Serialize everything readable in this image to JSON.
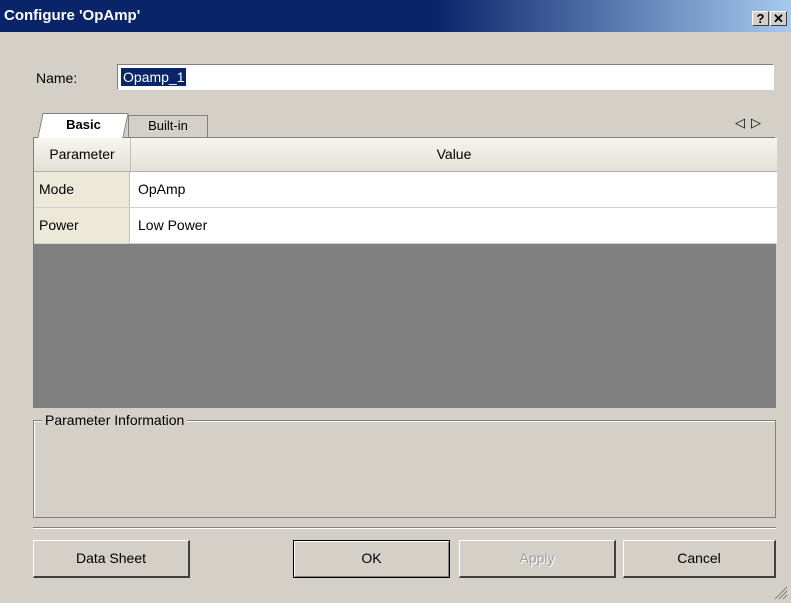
{
  "window": {
    "title": "Configure 'OpAmp'",
    "help_glyph": "?",
    "close_glyph": "✕"
  },
  "name_field": {
    "label": "Name:",
    "value": "Opamp_1"
  },
  "tabs": [
    {
      "label": "Basic",
      "active": true
    },
    {
      "label": "Built-in",
      "active": false
    }
  ],
  "tab_nav": {
    "left": "◁",
    "right": "▷"
  },
  "grid": {
    "headers": {
      "parameter": "Parameter",
      "value": "Value"
    },
    "rows": [
      {
        "parameter": "Mode",
        "value": "OpAmp"
      },
      {
        "parameter": "Power",
        "value": "Low Power"
      }
    ]
  },
  "info": {
    "label": "Parameter Information"
  },
  "buttons": {
    "datasheet": "Data Sheet",
    "ok": "OK",
    "apply": "Apply",
    "cancel": "Cancel"
  },
  "colors": {
    "titlebar": "#0a246a",
    "dialog_bg": "#d4d0c8",
    "grid_empty": "#808080",
    "selection": "#0a246a"
  }
}
